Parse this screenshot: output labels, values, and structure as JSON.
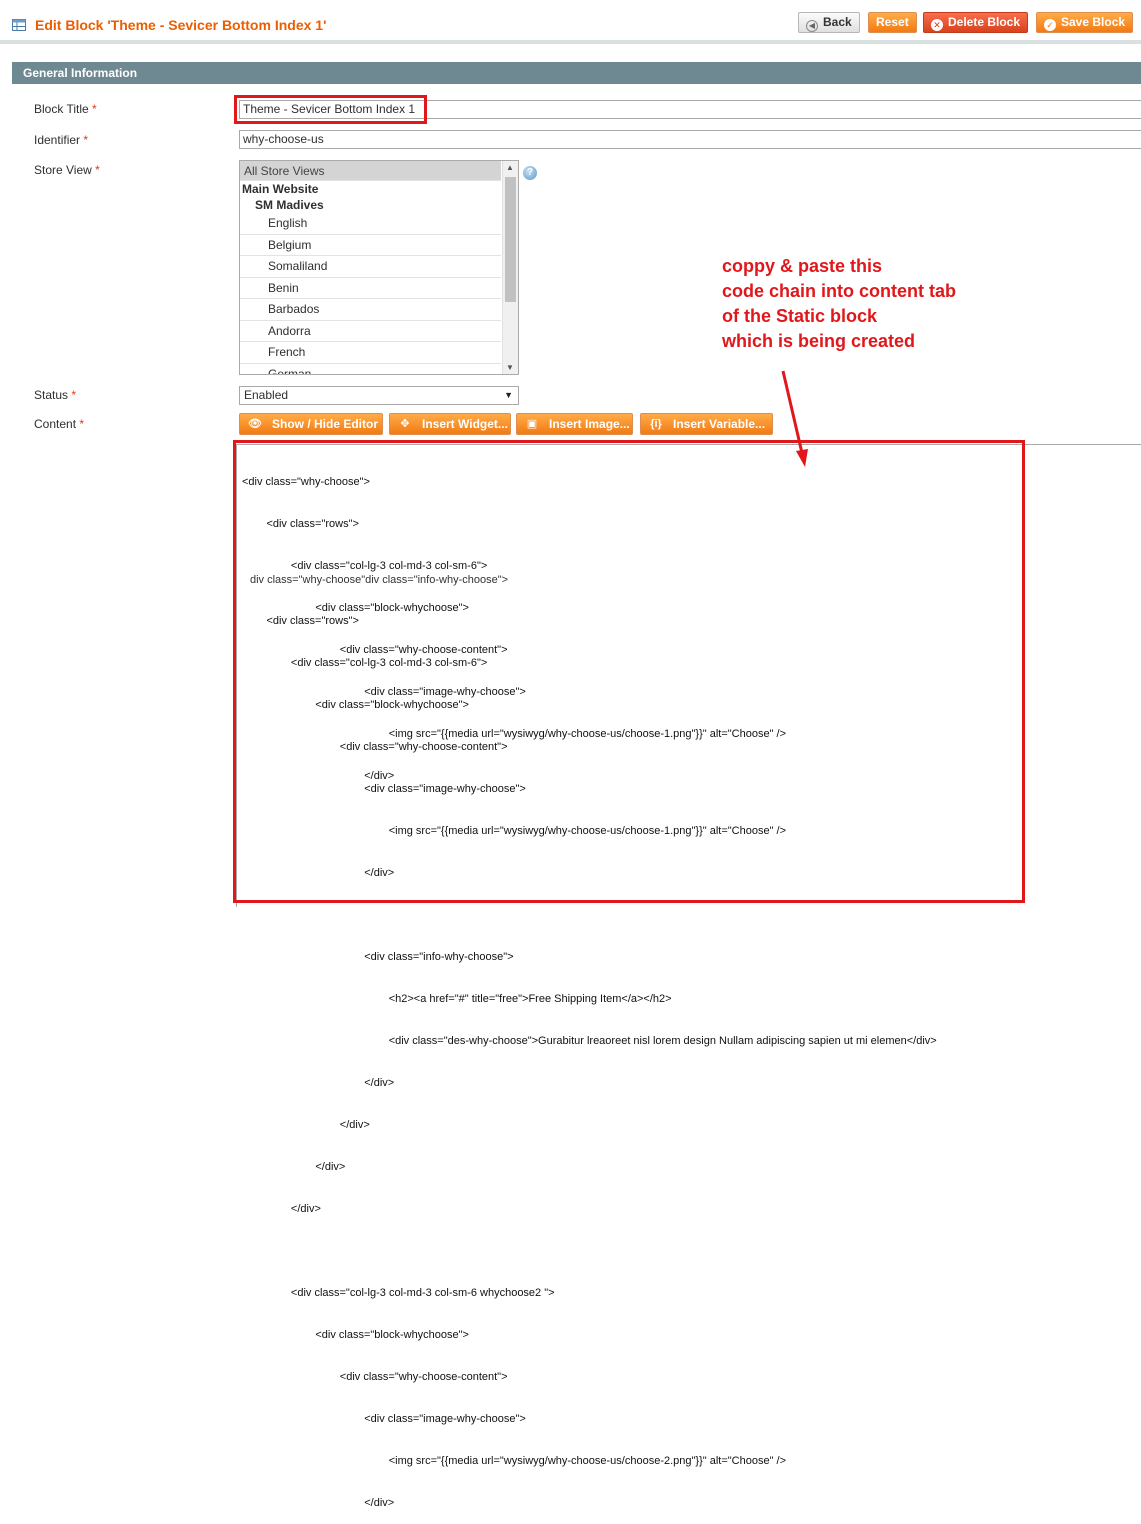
{
  "header": {
    "title": "Edit Block 'Theme - Sevicer Bottom Index 1'",
    "buttons": {
      "back": "Back",
      "reset": "Reset",
      "delete": "Delete Block",
      "save": "Save Block"
    }
  },
  "section": {
    "title": "General Information"
  },
  "form": {
    "block_title": {
      "label": "Block Title",
      "value": "Theme - Sevicer Bottom Index 1"
    },
    "identifier": {
      "label": "Identifier",
      "value": "why-choose-us"
    },
    "store_view": {
      "label": "Store View",
      "selected": "All Store Views",
      "website": "Main Website",
      "store": "SM Madives",
      "options": [
        "English",
        "Belgium",
        "Somaliland",
        "Benin",
        "Barbados",
        "Andorra",
        "French",
        "German"
      ]
    },
    "status": {
      "label": "Status",
      "value": "Enabled"
    },
    "content": {
      "label": "Content"
    },
    "required_mark": "*"
  },
  "toolbar": {
    "show_hide": "Show / Hide Editor",
    "insert_widget": "Insert Widget...",
    "insert_image": "Insert Image...",
    "insert_variable": "Insert Variable..."
  },
  "editor": {
    "lines_top": [
      "<div class=\"why-choose\">",
      "        <div class=\"rows\">",
      "                <div class=\"col-lg-3 col-md-3 col-sm-6\">",
      "                        <div class=\"block-whychoose\">",
      "                                <div class=\"why-choose-content\">",
      "                                        <div class=\"image-why-choose\">",
      "                                                <img src=\"{{media url=\"wysiwyg/why-choose-us/choose-1.png\"}}\" alt=\"Choose\" />",
      "                                        </div>"
    ],
    "overlap_line": "div class=\"why-choose\"div class=\"info-why-choose\">",
    "lines_bottom": [
      "        <div class=\"rows\">",
      "                <div class=\"col-lg-3 col-md-3 col-sm-6\">",
      "                        <div class=\"block-whychoose\">",
      "                                <div class=\"why-choose-content\">",
      "                                        <div class=\"image-why-choose\">",
      "                                                <img src=\"{{media url=\"wysiwyg/why-choose-us/choose-1.png\"}}\" alt=\"Choose\" />",
      "                                        </div>",
      "",
      "                                        <div class=\"info-why-choose\">",
      "                                                <h2><a href=\"#\" title=\"free\">Free Shipping Item</a></h2>",
      "                                                <div class=\"des-why-choose\">Gurabitur lreaoreet nisl lorem design Nullam adipiscing sapien ut mi elemen</div>",
      "                                        </div>",
      "                                </div>",
      "                        </div>",
      "                </div>",
      "",
      "                <div class=\"col-lg-3 col-md-3 col-sm-6 whychoose2 \">",
      "                        <div class=\"block-whychoose\">",
      "                                <div class=\"why-choose-content\">",
      "                                        <div class=\"image-why-choose\">",
      "                                                <img src=\"{{media url=\"wysiwyg/why-choose-us/choose-2.png\"}}\" alt=\"Choose\" />",
      "                                        </div>"
    ]
  },
  "annotation": {
    "lines": [
      "coppy & paste this",
      "code chain into content tab",
      "of the Static block",
      "which is being created"
    ]
  },
  "colors": {
    "accent_orange": "#eb5e00",
    "button_orange": "#f27a14",
    "section_bar": "#6f8992",
    "highlight_red": "#e0181b"
  }
}
